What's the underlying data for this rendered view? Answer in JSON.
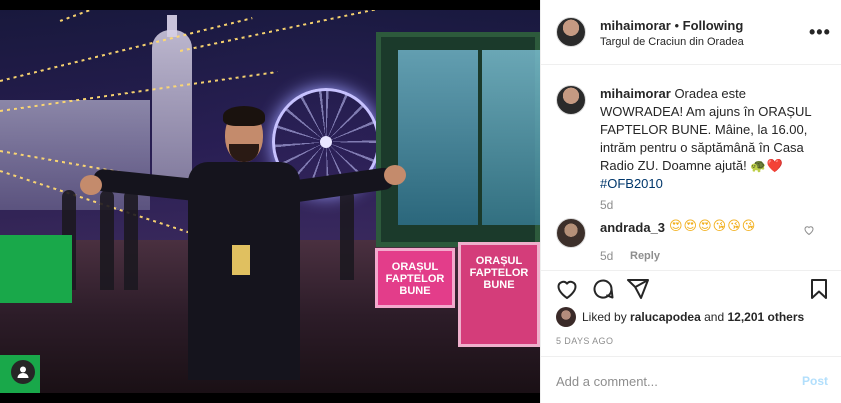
{
  "post": {
    "username": "mihaimorar",
    "follow_status": "Following",
    "separator": "•",
    "location": "Targul de Craciun din Oradea",
    "more_label": "•••"
  },
  "photo": {
    "sign_left": "ORAȘUL FAPTELOR BUNE",
    "sign_right": "ORAȘUL FAPTELOR BUNE",
    "user_tag_icon": "person-icon"
  },
  "caption": {
    "username": "mihaimorar",
    "text": "Oradea este WOWRADEA! Am ajuns în ORAȘUL FAPTELOR BUNE. Mâine, la 16.00, intrăm pentru o săptămână în Casa Radio ZU. Doamne ajută! 🐢❤️",
    "hashtag": "#OFB2010",
    "time": "5d"
  },
  "comment": {
    "username": "andrada_3",
    "text": "😍😍😍😘😘😘",
    "time": "5d",
    "reply_label": "Reply",
    "like_icon": "heart-outline-icon"
  },
  "actions": {
    "like": "heart-icon",
    "comment": "comment-icon",
    "share": "share-icon",
    "save": "bookmark-icon"
  },
  "likes": {
    "prefix": "Liked by",
    "user": "ralucapodea",
    "middle": "and",
    "count": "12,201 others"
  },
  "date": "5 DAYS AGO",
  "add_comment": {
    "placeholder": "Add a comment...",
    "post_label": "Post"
  },
  "colors": {
    "link": "#00376b",
    "muted": "#8e8e8e",
    "post_disabled": "#b2dffc"
  }
}
